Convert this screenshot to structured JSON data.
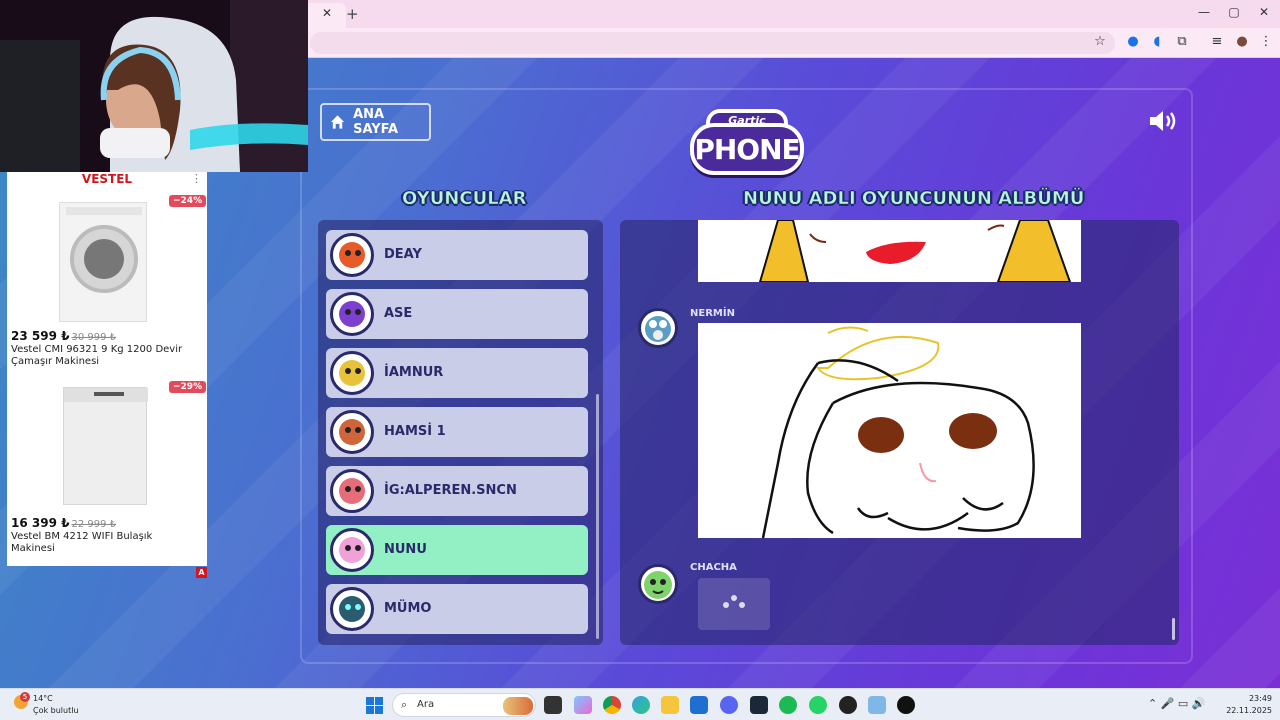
{
  "browser": {
    "tab_close": "✕",
    "new_tab": "+",
    "window_controls": {
      "minimize": "—",
      "maximize": "▢",
      "close": "✕"
    },
    "toolbar_icons": [
      "star-icon",
      "extension-icon",
      "puzzle-icon",
      "menu-icon"
    ]
  },
  "game": {
    "home_button_label": "ANA SAYFA",
    "logo_small": "Gartic",
    "logo_large": "PHONE",
    "players_title": "OYUNCULAR",
    "album_title": "NUNU ADLI OYUNCUNUN ALBÜMÜ",
    "players": [
      {
        "name": "DEAY",
        "color": "#e85a2a",
        "active": false
      },
      {
        "name": "ASE",
        "color": "#7d3fd0",
        "active": false
      },
      {
        "name": "İAMNUR",
        "color": "#e8c23a",
        "active": false
      },
      {
        "name": "HAMSİ 1",
        "color": "#d0643a",
        "active": false
      },
      {
        "name": "İG:ALPEREN.SNCN",
        "color": "#e86b7a",
        "active": false
      },
      {
        "name": "NUNU",
        "color": "#f2a0d8",
        "active": true
      },
      {
        "name": "MÜMO",
        "color": "#2a5b6e",
        "active": false
      }
    ],
    "album": [
      {
        "author": "NERMİN"
      },
      {
        "author": "CHACHA"
      }
    ],
    "accent_color": "#93f0c5"
  },
  "ad": {
    "brand": "VESTEL",
    "more": "⋮",
    "badge": "A",
    "products": [
      {
        "discount": "−24%",
        "price": "23 599 ₺",
        "old_price": "30 999 ₺",
        "name": "Vestel CMI 96321 9 Kg 1200 Devir Çamaşır Makinesi"
      },
      {
        "discount": "−29%",
        "price": "16 399 ₺",
        "old_price": "22 999 ₺",
        "name": "Vestel BM 4212 WIFI Bulaşık Makinesi"
      }
    ]
  },
  "taskbar": {
    "weather_badge": "5",
    "temperature": "14°C",
    "condition": "Çok bulutlu",
    "search_placeholder": "Ara",
    "time": "23:49",
    "date": "22.11.2025"
  }
}
